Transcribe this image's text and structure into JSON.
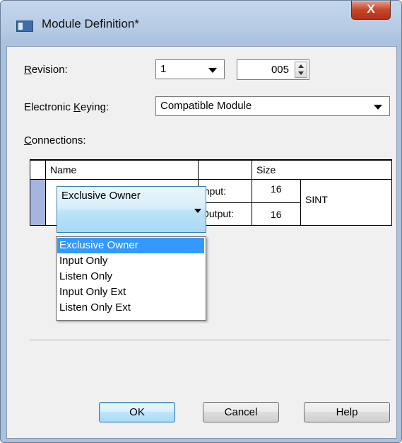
{
  "window": {
    "title": "Module Definition*",
    "close_label": "X"
  },
  "revision": {
    "label": "Revision:",
    "label_accel": "R",
    "label_rest": "evision:",
    "major": "1",
    "minor": "005"
  },
  "keying": {
    "label_pre": "Electronic ",
    "label_accel": "K",
    "label_rest": "eying:",
    "value": "Compatible Module"
  },
  "connections": {
    "label_accel": "C",
    "label_rest": "onnections:",
    "columns": {
      "name": "Name",
      "blank": "",
      "size": "Size"
    },
    "row": {
      "name": "Exclusive Owner",
      "input_label": "Input:",
      "input_size": "16",
      "output_label": "Output:",
      "output_size": "16",
      "type": "SINT"
    },
    "options": [
      "Exclusive Owner",
      "Input Only",
      "Listen Only",
      "Input Only Ext",
      "Listen Only Ext"
    ],
    "selected_option": "Exclusive Owner"
  },
  "buttons": {
    "ok": "OK",
    "cancel": "Cancel",
    "help": "Help"
  },
  "colors": {
    "selection": "#3399ff",
    "row_header": "#a4b6dd",
    "close_button": "#c8452a"
  }
}
